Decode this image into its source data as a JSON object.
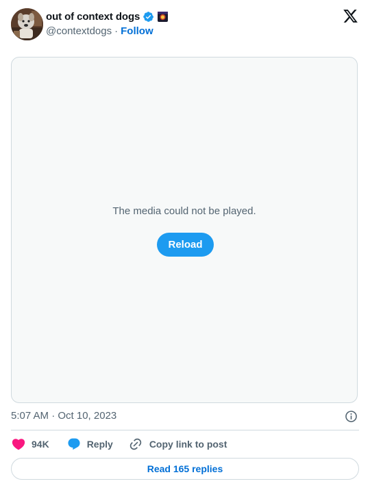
{
  "author": {
    "display_name": "out of context dogs",
    "handle": "@contextdogs",
    "separator": "·",
    "follow_label": "Follow",
    "verified_icon": "verified-badge-icon",
    "flag_icon": "flag-emoji-icon"
  },
  "brand": {
    "logo_icon": "x-logo-icon"
  },
  "media": {
    "error_text": "The media could not be played.",
    "reload_label": "Reload"
  },
  "tweet": {
    "timestamp": "5:07 AM · Oct 10, 2023",
    "info_icon": "info-icon"
  },
  "actions": {
    "like_count": "94K",
    "reply_label": "Reply",
    "copy_label": "Copy link to post"
  },
  "footer": {
    "read_replies_label": "Read 165 replies"
  },
  "colors": {
    "accent": "#1d9bf0",
    "link": "#006fd6",
    "like": "#f91880",
    "muted_text": "#536471",
    "border": "#cfd9de",
    "media_bg": "#f7f9f9"
  }
}
